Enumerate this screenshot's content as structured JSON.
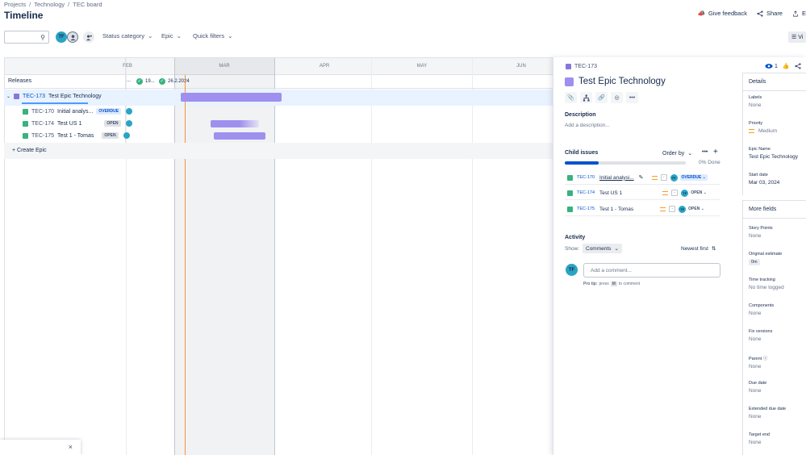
{
  "breadcrumb": [
    "Projects",
    "Technology",
    "TEC board"
  ],
  "breadcrumb_sep": "/",
  "page_title": "Timeline",
  "top_actions": {
    "feedback": "Give feedback",
    "share": "Share",
    "export": "E"
  },
  "toolbar": {
    "search_value": "",
    "avatar_initials": "TF",
    "filters": [
      "Status category",
      "Epic",
      "Quick filters"
    ],
    "view_label": "Vi"
  },
  "timeline": {
    "months": [
      "FEB",
      "MAR",
      "APR",
      "MAY",
      "JUN"
    ],
    "releases_label": "Releases",
    "release_markers": [
      "...",
      "19...",
      "26.2.2024"
    ],
    "epic": {
      "key": "TEC-173",
      "title": "Test Epic Technology"
    },
    "children": [
      {
        "key": "TEC-170",
        "title": "Initial analys...",
        "status": "OVERDUE"
      },
      {
        "key": "TEC-174",
        "title": "Test US 1",
        "status": "OPEN"
      },
      {
        "key": "TEC-175",
        "title": "Test 1 - Tomas",
        "status": "OPEN"
      }
    ],
    "create_epic": "+ Create Epic",
    "close_glyph": "×"
  },
  "panel": {
    "issue_key": "TEC-173",
    "watch_count": "1",
    "title": "Test Epic Technology",
    "description_label": "Description",
    "description_placeholder": "Add a description...",
    "child_issues_label": "Child issues",
    "order_by": "Order by",
    "progress_fraction": 0.28,
    "done_text": "0% Done",
    "children": [
      {
        "key": "TEC-170",
        "title": "Initial analysi...",
        "dash": "-",
        "avatar": "TF",
        "status": "OVERDUE"
      },
      {
        "key": "TEC-174",
        "title": "Test US 1",
        "dash": "-",
        "avatar": "TF",
        "status": "OPEN"
      },
      {
        "key": "TEC-175",
        "title": "Test 1 - Tomas",
        "dash": "-",
        "avatar": "TF",
        "status": "OPEN"
      }
    ],
    "activity_label": "Activity",
    "show_label": "Show:",
    "comments_filter": "Comments",
    "sort_label": "Newest first",
    "comment_avatar": "TF",
    "comment_placeholder": "Add a comment...",
    "pro_tip": {
      "prefix": "Pro tip:",
      "press": "press",
      "key": "M",
      "suffix": "to comment"
    }
  },
  "details": {
    "header": "Details",
    "fields": [
      {
        "label": "Labels",
        "value": "None"
      },
      {
        "label": "Priority",
        "value": "Medium"
      },
      {
        "label": "Epic Name",
        "value": "Test Epic Technology"
      },
      {
        "label": "Start date",
        "value": "Mar 03, 2024"
      }
    ],
    "more_header": "More fields",
    "more_fields": [
      {
        "label": "Story Points",
        "value": "None"
      },
      {
        "label": "Original estimate",
        "value": "0m"
      },
      {
        "label": "Time tracking",
        "value": "No time logged"
      },
      {
        "label": "Components",
        "value": "None"
      },
      {
        "label": "Fix versions",
        "value": "None"
      },
      {
        "label": "Parent",
        "value": "None"
      },
      {
        "label": "Due date",
        "value": "None"
      },
      {
        "label": "Extended due date",
        "value": "None"
      },
      {
        "label": "Target end",
        "value": "None"
      }
    ]
  },
  "colors": {
    "accent": "#0052cc",
    "epic": "#8777d9",
    "story": "#36b37e",
    "bar": "#9f8fef",
    "today": "#f79233"
  }
}
